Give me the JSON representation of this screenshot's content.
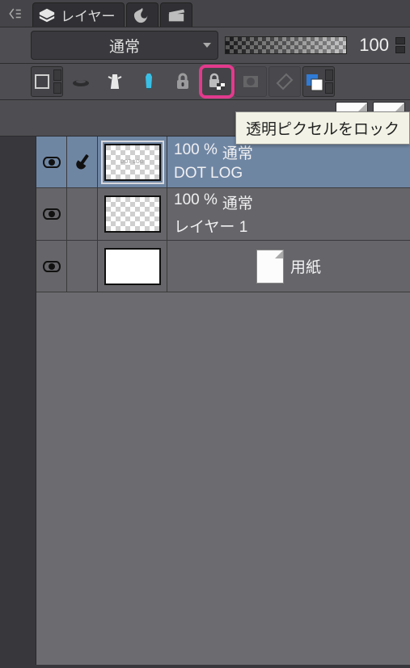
{
  "tabs": {
    "active_label": "レイヤー"
  },
  "blend": {
    "mode": "通常",
    "opacity": "100"
  },
  "toolbar": {
    "tooltip": "透明ピクセルをロック"
  },
  "layers": [
    {
      "opacity": "100 %",
      "blend": "通常",
      "name": "DOT LOG",
      "thumb_text": "DOT LOG",
      "selected": true,
      "checker": true,
      "visible": true,
      "editing": true
    },
    {
      "opacity": "100 %",
      "blend": "通常",
      "name": "レイヤー 1",
      "selected": false,
      "checker": true,
      "visible": true,
      "editing": false
    },
    {
      "name": "用紙",
      "selected": false,
      "checker": false,
      "visible": true,
      "editing": false,
      "is_paper": true
    }
  ]
}
